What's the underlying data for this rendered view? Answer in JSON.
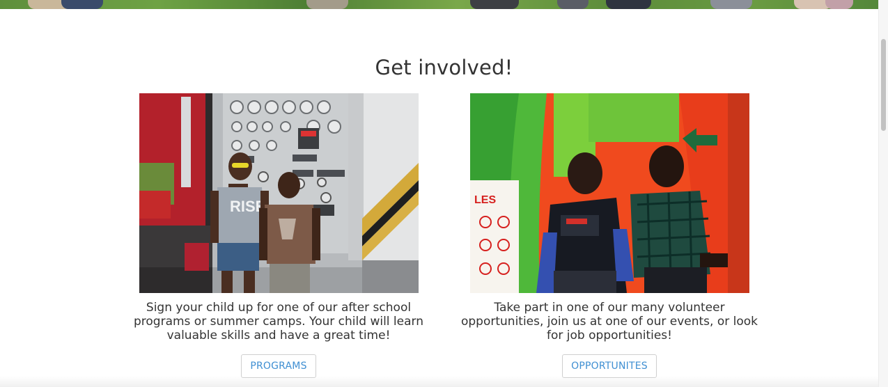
{
  "section": {
    "heading": "Get involved!"
  },
  "cards": [
    {
      "text": "Sign your child up for one of our after school programs or summer camps. Your child will learn valuable skills and have a great time!",
      "button_label": "PROGRAMS"
    },
    {
      "text": "Take part in one of our many volunteer opportunities, join us at one of our events, or look for job opportunities!",
      "button_label": "OPPORTUNITES"
    }
  ],
  "colors": {
    "link": "#3f8fd2",
    "heading": "#333333"
  }
}
